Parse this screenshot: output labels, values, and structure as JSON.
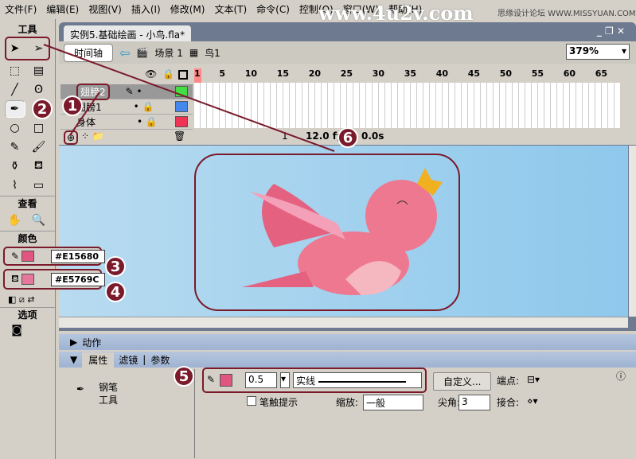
{
  "menu": [
    "文件(F)",
    "编辑(E)",
    "视图(V)",
    "插入(I)",
    "修改(M)",
    "文本(T)",
    "命令(C)",
    "控制(O)",
    "窗口(W)",
    "帮助(H)"
  ],
  "watermark": {
    "site": "www.4u2v.com",
    "forum": "思缘设计论坛 WWW.MISSYUAN.COM"
  },
  "toolbox": {
    "tools_label": "工具",
    "view_label": "查看",
    "colors_label": "颜色",
    "options_label": "选项",
    "stroke_color": "#E15680",
    "fill_color": "#E5769C"
  },
  "document": {
    "tab": "实例5.基础绘画 - 小鸟.fla*",
    "timeline_button": "时间轴",
    "scene": "场景 1",
    "symbol": "鸟1",
    "zoom": "379%"
  },
  "timeline": {
    "ruler": [
      "1",
      "5",
      "10",
      "15",
      "20",
      "25",
      "30",
      "35",
      "40",
      "45",
      "50",
      "55",
      "60",
      "65"
    ],
    "layers": [
      {
        "name": "翅膀2",
        "color": "#44dd44"
      },
      {
        "name": "翅膀1",
        "color": "#4488ee"
      },
      {
        "name": "身体",
        "color": "#ee3355"
      }
    ],
    "current_frame": "1",
    "fps": "12.0 fps",
    "time": "0.0s"
  },
  "panels": {
    "actions": "动作",
    "tabs": [
      "属性",
      "滤镜",
      "参数"
    ],
    "tool_name_1": "钢笔",
    "tool_name_2": "工具",
    "stroke_width": "0.5",
    "stroke_style": "实线",
    "custom_button": "自定义...",
    "cap_label": "端点:",
    "stroke_hint": "笔触提示",
    "scale_label": "缩放:",
    "scale_value": "一般",
    "miter_label": "尖角:",
    "miter_value": "3",
    "join_label": "接合:"
  },
  "callouts": [
    "1",
    "2",
    "3",
    "4",
    "5",
    "6"
  ]
}
